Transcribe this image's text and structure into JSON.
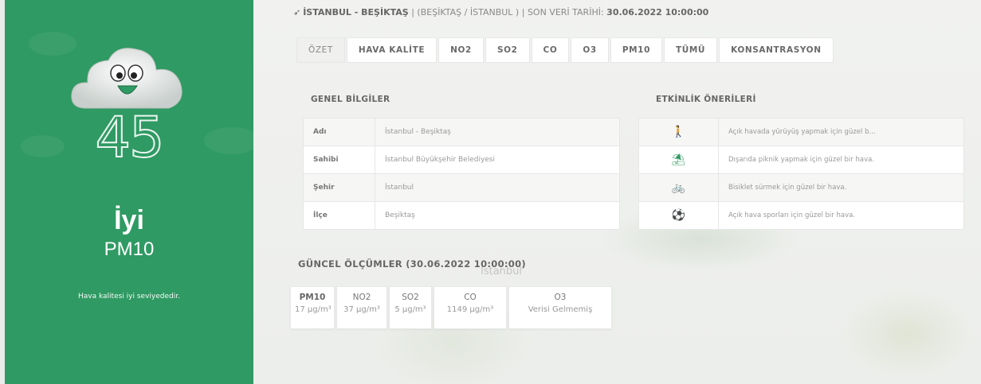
{
  "status": {
    "aqi": "45",
    "level": "İyi",
    "pollutant": "PM10",
    "description": "Hava kalitesi iyi seviyededir.",
    "color": "#2f9a63"
  },
  "header": {
    "location": "İSTANBUL - BEŞİKTAŞ",
    "sub_location": "(BEŞİKTAŞ / İSTANBUL )",
    "last_update_label": "SON VERİ TARİHİ:",
    "last_update_value": "30.06.2022 10:00:00",
    "sep1": "|",
    "sep2": "|"
  },
  "tabs": [
    "ÖZET",
    "HAVA KALİTE",
    "NO2",
    "SO2",
    "CO",
    "O3",
    "PM10",
    "TÜMÜ",
    "KONSANTRASYON"
  ],
  "general": {
    "title": "GENEL BİLGİLER",
    "rows": [
      {
        "key": "Adı",
        "value": "İstanbul - Beşiktaş"
      },
      {
        "key": "Sahibi",
        "value": "İstanbul Büyükşehir Belediyesi"
      },
      {
        "key": "Şehir",
        "value": "İstanbul"
      },
      {
        "key": "İlçe",
        "value": "Beşiktaş"
      }
    ]
  },
  "activities": {
    "title": "ETKİNLİK ÖNERİLERİ",
    "rows": [
      {
        "icon": "walking-icon",
        "glyph": "🚶",
        "text": "Açık havada yürüyüş yapmak için güzel b..."
      },
      {
        "icon": "picnic-icon",
        "glyph": "⛱",
        "text": "Dışarıda piknik yapmak için güzel bir hava."
      },
      {
        "icon": "bicycle-icon",
        "glyph": "🚲",
        "text": "Bisiklet sürmek için güzel bir hava."
      },
      {
        "icon": "ball-icon",
        "glyph": "⚽",
        "text": "Açık hava sporları için güzel bir hava."
      }
    ]
  },
  "measurements": {
    "title": "GÜNCEL ÖLÇÜMLER (30.06.2022 10:00:00)",
    "items": [
      {
        "name": "PM10",
        "value": "17 µg/m³"
      },
      {
        "name": "NO2",
        "value": "37 µg/m³"
      },
      {
        "name": "SO2",
        "value": "5 µg/m³"
      },
      {
        "name": "CO",
        "value": "1149 µg/m³"
      },
      {
        "name": "O3",
        "value": "Verisi Gelmemiş"
      }
    ]
  },
  "map_label": "İstanbul"
}
